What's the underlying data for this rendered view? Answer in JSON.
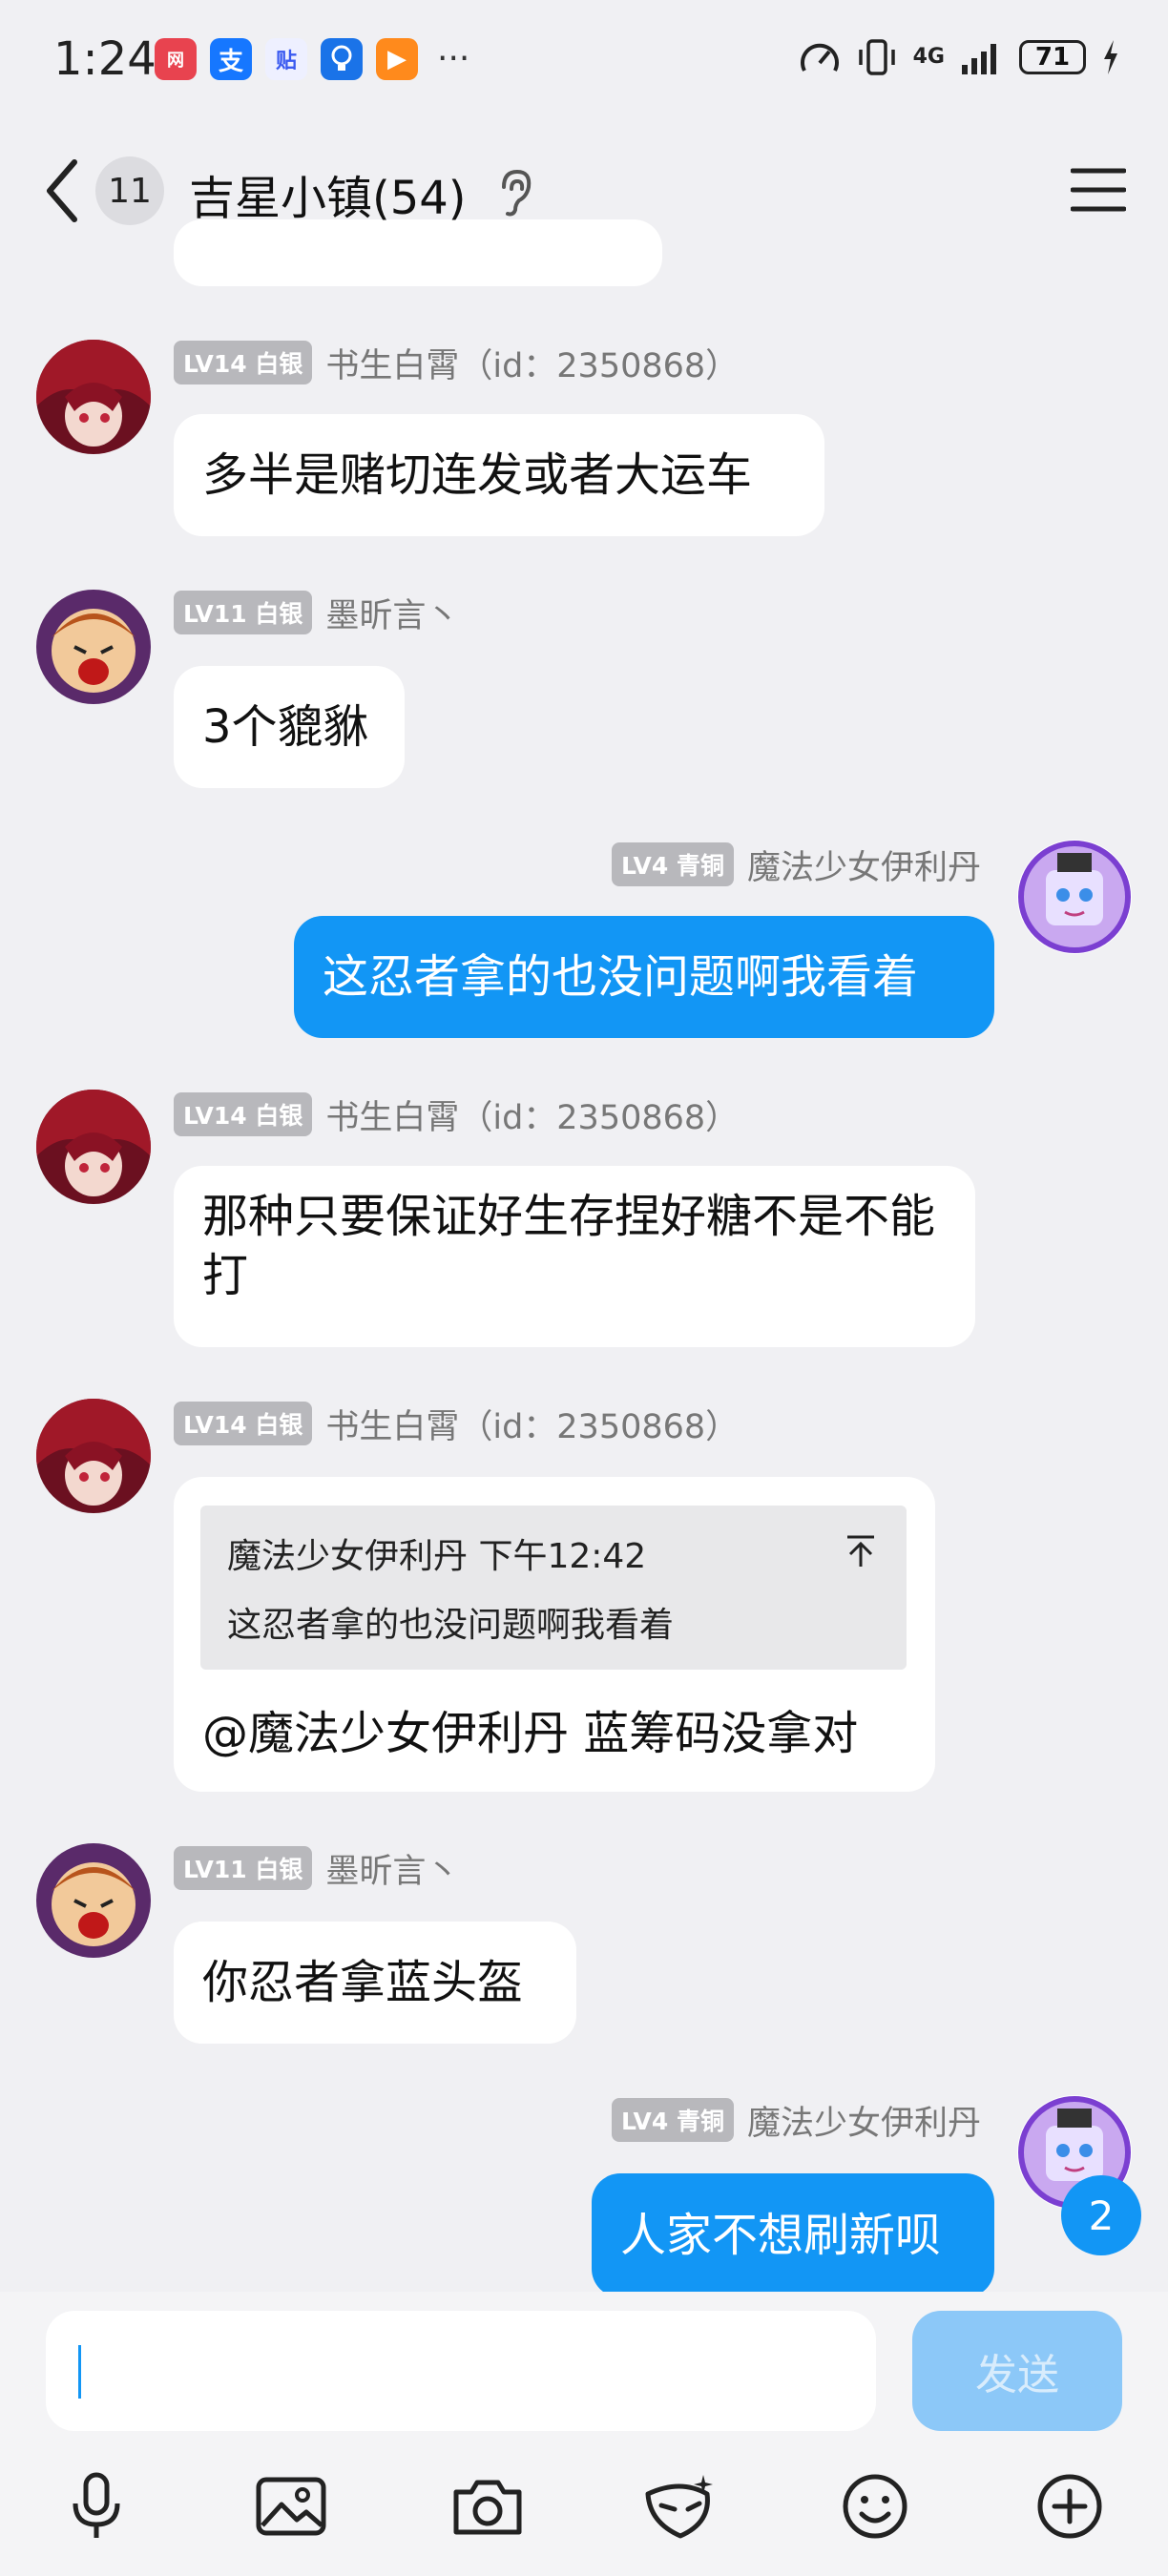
{
  "status": {
    "time": "1:24",
    "network": "4G",
    "battery": "71",
    "more": "···",
    "app_icons": [
      "网",
      "支",
      "贴",
      "",
      "▶"
    ]
  },
  "nav": {
    "unread": "11",
    "title": "吉星小镇(54)"
  },
  "messages": [
    {
      "level": "LV14 白银",
      "name": "书生白霄（id：2350868）",
      "text": "多半是赌切连发或者大运车"
    },
    {
      "level": "LV11 白银",
      "name": "墨昕言丶",
      "text": "3个貔貅"
    },
    {
      "level": "LV4 青铜",
      "name": "魔法少女伊利丹",
      "text": "这忍者拿的也没问题啊我看着"
    },
    {
      "level": "LV14 白银",
      "name": "书生白霄（id：2350868）",
      "text": "那种只要保证好生存捏好糖不是不能打"
    },
    {
      "level": "LV14 白银",
      "name": "书生白霄（id：2350868）",
      "text": "@魔法少女伊利丹 蓝筹码没拿对",
      "quote": {
        "head": "魔法少女伊利丹 下午12:42",
        "text": "这忍者拿的也没问题啊我看着"
      }
    },
    {
      "level": "LV11 白银",
      "name": "墨昕言丶",
      "text": "你忍者拿蓝头盔"
    },
    {
      "level": "LV4 青铜",
      "name": "魔法少女伊利丹",
      "text": "人家不想刷新呗"
    }
  ],
  "unread_new": "2",
  "input": {
    "value": "",
    "send_label": "发送"
  },
  "tools": [
    "microphone-icon",
    "image-icon",
    "camera-icon",
    "mask-icon",
    "emoji-icon",
    "plus-icon"
  ],
  "colors": {
    "accent": "#1296f5",
    "send_disabled": "#8cc8f8"
  }
}
